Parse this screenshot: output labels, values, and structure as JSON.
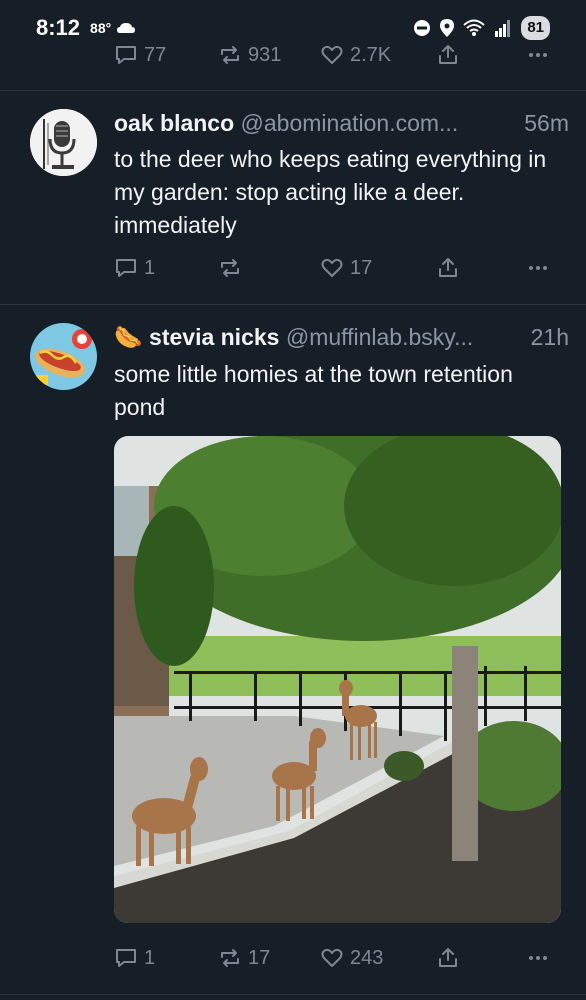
{
  "status_bar": {
    "time": "8:12",
    "temperature": "88°",
    "battery": "81"
  },
  "top_post": {
    "replies": "77",
    "reposts": "931",
    "likes": "2.7K"
  },
  "posts": [
    {
      "display_name": "oak blanco",
      "handle": "@abomination.com...",
      "time": "56m",
      "text": "to the deer who keeps eating everything in my garden: stop acting like a deer. immediately",
      "replies": "1",
      "reposts": "",
      "likes": "17"
    },
    {
      "emoji": "🌭",
      "display_name": "stevia nicks",
      "handle": "@muffinlab.bsky...",
      "time": "21h",
      "text": "some little homies at the town retention pond",
      "replies": "1",
      "reposts": "17",
      "likes": "243"
    }
  ],
  "colors": {
    "background": "#161e27",
    "muted": "#7d8894",
    "text": "#f1f3f5"
  }
}
